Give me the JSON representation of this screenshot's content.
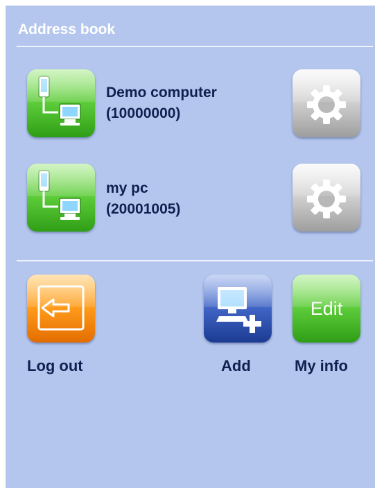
{
  "header": {
    "title": "Address book"
  },
  "entries": [
    {
      "name": "Demo computer",
      "id": "(10000000)"
    },
    {
      "name": "my pc",
      "id": "(20001005)"
    }
  ],
  "actions": {
    "logout_label": "Log out",
    "add_label": "Add",
    "myinfo_label": "My info",
    "edit_text": "Edit"
  },
  "colors": {
    "panel_background": "#b4c6ed",
    "text": "#102050",
    "connect_tile": "#5ccb39",
    "settings_tile": "#cfcfcf",
    "logout_tile": "#ff9a1a",
    "add_tile": "#3f64c4"
  },
  "icons": {
    "connect": "phone-to-computer-icon",
    "settings": "gear-icon",
    "logout": "logout-icon",
    "add": "add-computer-icon"
  }
}
